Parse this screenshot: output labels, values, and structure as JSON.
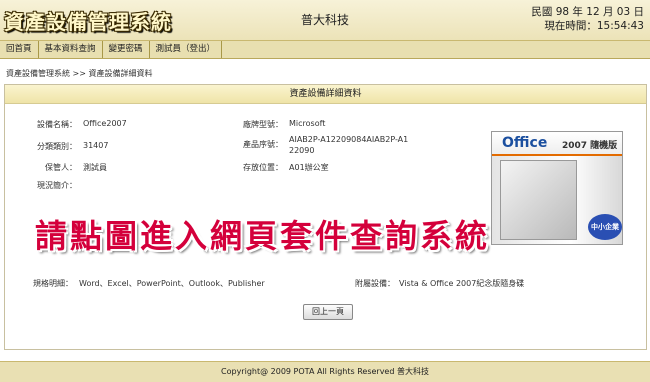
{
  "header": {
    "logo_text": "資產設備管理系統",
    "company": "普大科技",
    "date_line": "民國 98 年 12 月 03 日",
    "time_line": "現在時間：15:54:43"
  },
  "menu": [
    "回首頁",
    "基本資料查詢",
    "變更密碼",
    "測試員（登出）"
  ],
  "breadcrumb": "資產設備管理系統 >> 資產設備詳細資料",
  "panel": {
    "title": "資產設備詳細資料",
    "fields": {
      "name_label": "設備名稱：",
      "name_value": "Office2007",
      "brand_label": "廠牌型號：",
      "brand_value": "Microsoft",
      "category_label": "分類類別：",
      "category_value": "31407",
      "serial_label": "產品序號：",
      "serial_value": "AIAB2P-A12209084AIAB2P-A122090",
      "keeper_label": "保管人：",
      "keeper_value": "測試員",
      "location_label": "存放位置：",
      "location_value": "A01辦公室",
      "status_label": "現況簡介：",
      "status_value": "",
      "spec_label": "規格明細：",
      "spec_value": "Word、Excel、PowerPoint、Outlook、Publisher",
      "accessory_label": "附屬設備：",
      "accessory_value": "Vista & Office 2007紀念版隨身碟"
    },
    "product_image": {
      "brand_text": "Office",
      "version_text": "2007 隨機版",
      "badge_text": "中小企業版"
    },
    "banner_text": "請點圖進入網頁套件查詢系統",
    "back_button": "回上一頁"
  },
  "footer": "Copyright@  2009  POTA  All  Rights  Reserved   普大科技"
}
